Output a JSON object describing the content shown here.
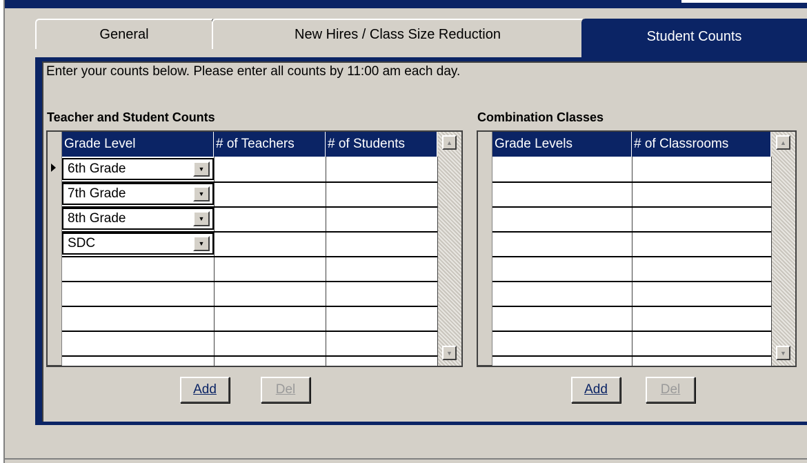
{
  "tabs": {
    "general": "General",
    "new_hires": "New Hires / Class Size Reduction",
    "student_counts": "Student Counts"
  },
  "instructions": "Enter your counts below.  Please enter all counts by 11:00 am each day.",
  "teacher_counts": {
    "title": "Teacher and Student Counts",
    "columns": [
      "Grade Level",
      "# of Teachers",
      "# of Students"
    ],
    "rows": [
      {
        "grade": "6th Grade",
        "teachers": "",
        "students": ""
      },
      {
        "grade": "7th Grade",
        "teachers": "",
        "students": ""
      },
      {
        "grade": "8th Grade",
        "teachers": "",
        "students": ""
      },
      {
        "grade": "SDC",
        "teachers": "",
        "students": ""
      }
    ],
    "add_label": "Add",
    "del_label": "Del"
  },
  "combination_classes": {
    "title": "Combination Classes",
    "columns": [
      "Grade Levels",
      "# of Classrooms"
    ],
    "add_label": "Add",
    "del_label": "Del"
  },
  "colors": {
    "accent": "#0b2465",
    "face": "#d4d0c8"
  },
  "icons": {
    "dropdown": "chevron-down-icon",
    "scroll_up": "scroll-up-icon",
    "scroll_down": "scroll-down-icon",
    "current_row": "current-row-pointer-icon"
  }
}
